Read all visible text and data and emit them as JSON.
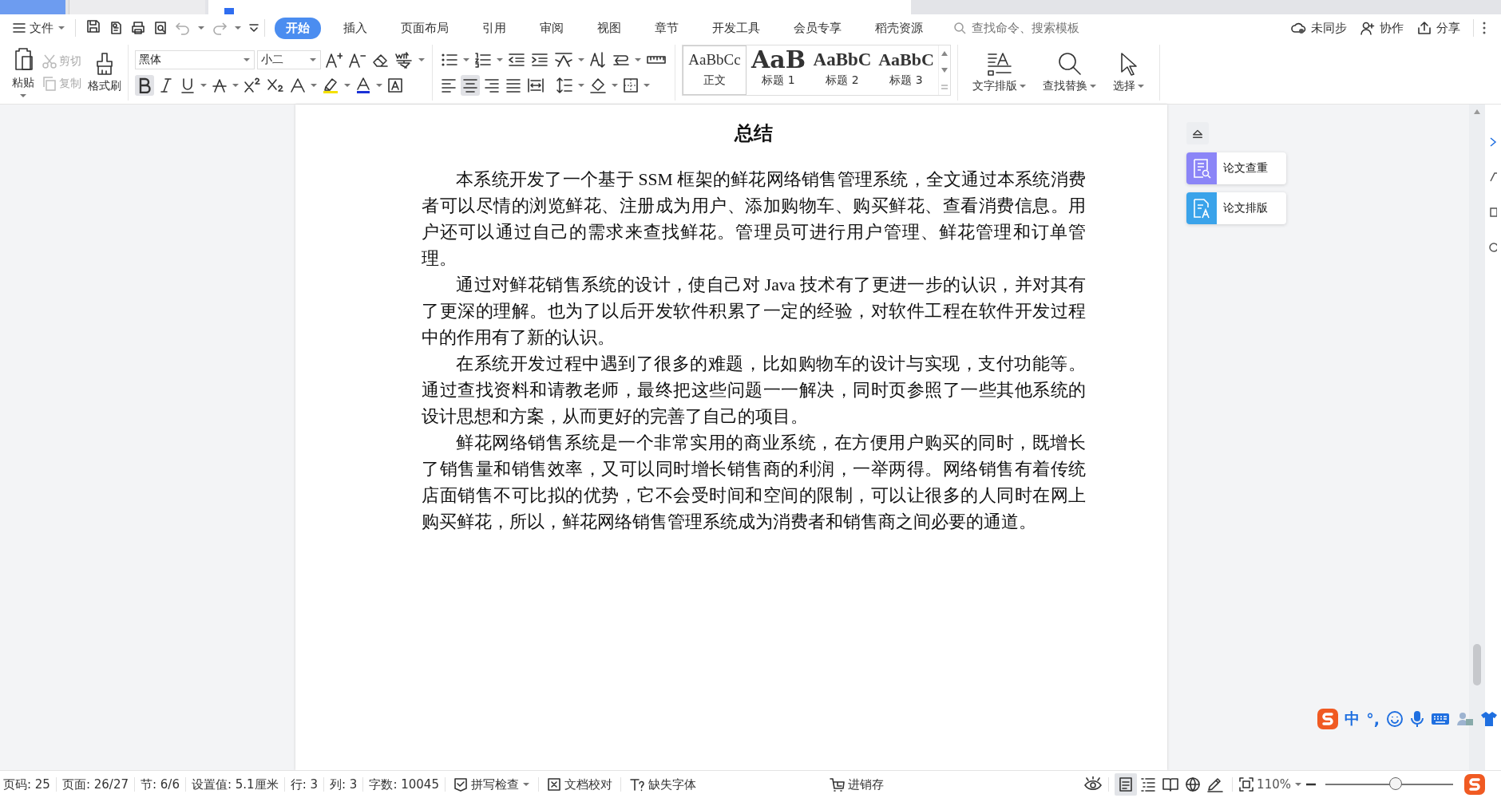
{
  "menu_bar": {
    "file_menu": "文件",
    "tabs": [
      {
        "label": "开始",
        "selected": true
      },
      {
        "label": "插入",
        "selected": false
      },
      {
        "label": "页面布局",
        "selected": false
      },
      {
        "label": "引用",
        "selected": false
      },
      {
        "label": "审阅",
        "selected": false
      },
      {
        "label": "视图",
        "selected": false
      },
      {
        "label": "章节",
        "selected": false
      },
      {
        "label": "开发工具",
        "selected": false
      },
      {
        "label": "会员专享",
        "selected": false
      },
      {
        "label": "稻壳资源",
        "selected": false
      }
    ],
    "search": {
      "placeholder": "查找命令、搜索模板"
    },
    "actions": [
      {
        "label": "未同步",
        "kind": "cloud"
      },
      {
        "label": "协作",
        "kind": "user"
      },
      {
        "label": "分享",
        "kind": "share"
      }
    ]
  },
  "ribbon": {
    "clipboard": [
      {
        "label": "粘贴",
        "kind": "paste",
        "disabled": false
      },
      {
        "label": "剪切",
        "kind": "cut",
        "disabled": true
      },
      {
        "label": "复制",
        "kind": "copy",
        "disabled": true
      },
      {
        "label": "格式刷",
        "kind": "brush",
        "disabled": false
      }
    ],
    "font": {
      "name": "黑体",
      "size": "小二"
    },
    "format_buttons": [
      {
        "kind": "bold",
        "selected": true
      },
      {
        "kind": "italic",
        "selected": false
      },
      {
        "kind": "underline",
        "selected": false
      },
      {
        "kind": "strike",
        "selected": false
      },
      {
        "kind": "sup",
        "selected": false
      },
      {
        "kind": "sub",
        "selected": false
      }
    ],
    "align_buttons": [
      {
        "kind": "left",
        "selected": false
      },
      {
        "kind": "center",
        "selected": true
      },
      {
        "kind": "right",
        "selected": false
      },
      {
        "kind": "justify",
        "selected": false
      },
      {
        "kind": "distribute",
        "selected": false
      }
    ],
    "styles": [
      {
        "sample": "AaBbCc",
        "label": "正文",
        "kind": "body"
      },
      {
        "sample": "AaB",
        "label": "标题 1",
        "kind": "h1"
      },
      {
        "sample": "AaBbC",
        "label": "标题 2",
        "kind": "h2"
      },
      {
        "sample": "AaBbC",
        "label": "标题 3",
        "kind": "h3"
      }
    ],
    "tools": [
      {
        "label": "文字排版",
        "kind": "layout"
      },
      {
        "label": "查找替换",
        "kind": "find"
      },
      {
        "label": "选择",
        "kind": "select"
      }
    ]
  },
  "document": {
    "title": "总结",
    "paragraphs": [
      "本系统开发了一个基于 SSM 框架的鲜花网络销售管理系统，全文通过本系统消费者可以尽情的浏览鲜花、注册成为用户、添加购物车、购买鲜花、查看消费信息。用户还可以通过自己的需求来查找鲜花。管理员可进行用户管理、鲜花管理和订单管理。",
      "通过对鲜花销售系统的设计，使自己对 Java 技术有了更进一步的认识，并对其有了更深的理解。也为了以后开发软件积累了一定的经验，对软件工程在软件开发过程中的作用有了新的认识。",
      "在系统开发过程中遇到了很多的难题，比如购物车的设计与实现，支付功能等。通过查找资料和请教老师，最终把这些问题一一解决，同时页参照了一些其他系统的设计思想和方案，从而更好的完善了自己的项目。",
      "鲜花网络销售系统是一个非常实用的商业系统，在方便用户购买的同时，既增长了销售量和销售效率，又可以同时增长销售商的利润，一举两得。网络销售有着传统店面销售不可比拟的优势，它不会受时间和空间的限制，可以让很多的人同时在网上购买鲜花，所以，鲜花网络销售管理系统成为消费者和销售商之间必要的通道。"
    ]
  },
  "side_panel": {
    "buttons": [
      {
        "label": "论文查重",
        "color": "#8b85f7",
        "kind": "check"
      },
      {
        "label": "论文排版",
        "color": "#3aa3ea",
        "kind": "format"
      }
    ]
  },
  "status_bar": {
    "items": [
      "页码: 25",
      "页面: 26/27",
      "节: 6/6",
      "设置值: 5.1厘米",
      "行: 3",
      "列: 3",
      "字数: 10045"
    ],
    "tools": [
      {
        "label": "拼写检查",
        "kind": "spell"
      },
      {
        "label": "文档校对",
        "kind": "proof"
      },
      {
        "label": "缺失字体",
        "kind": "font"
      }
    ],
    "app_button": "进销存",
    "view_modes": [
      {
        "kind": "page",
        "selected": true
      },
      {
        "kind": "outline",
        "selected": false
      },
      {
        "kind": "read",
        "selected": false
      },
      {
        "kind": "web",
        "selected": false
      },
      {
        "kind": "write",
        "selected": false
      }
    ],
    "zoom": {
      "value": "110%",
      "level": 0.55
    }
  },
  "ime": {
    "mode": "中",
    "punct": "°,"
  }
}
